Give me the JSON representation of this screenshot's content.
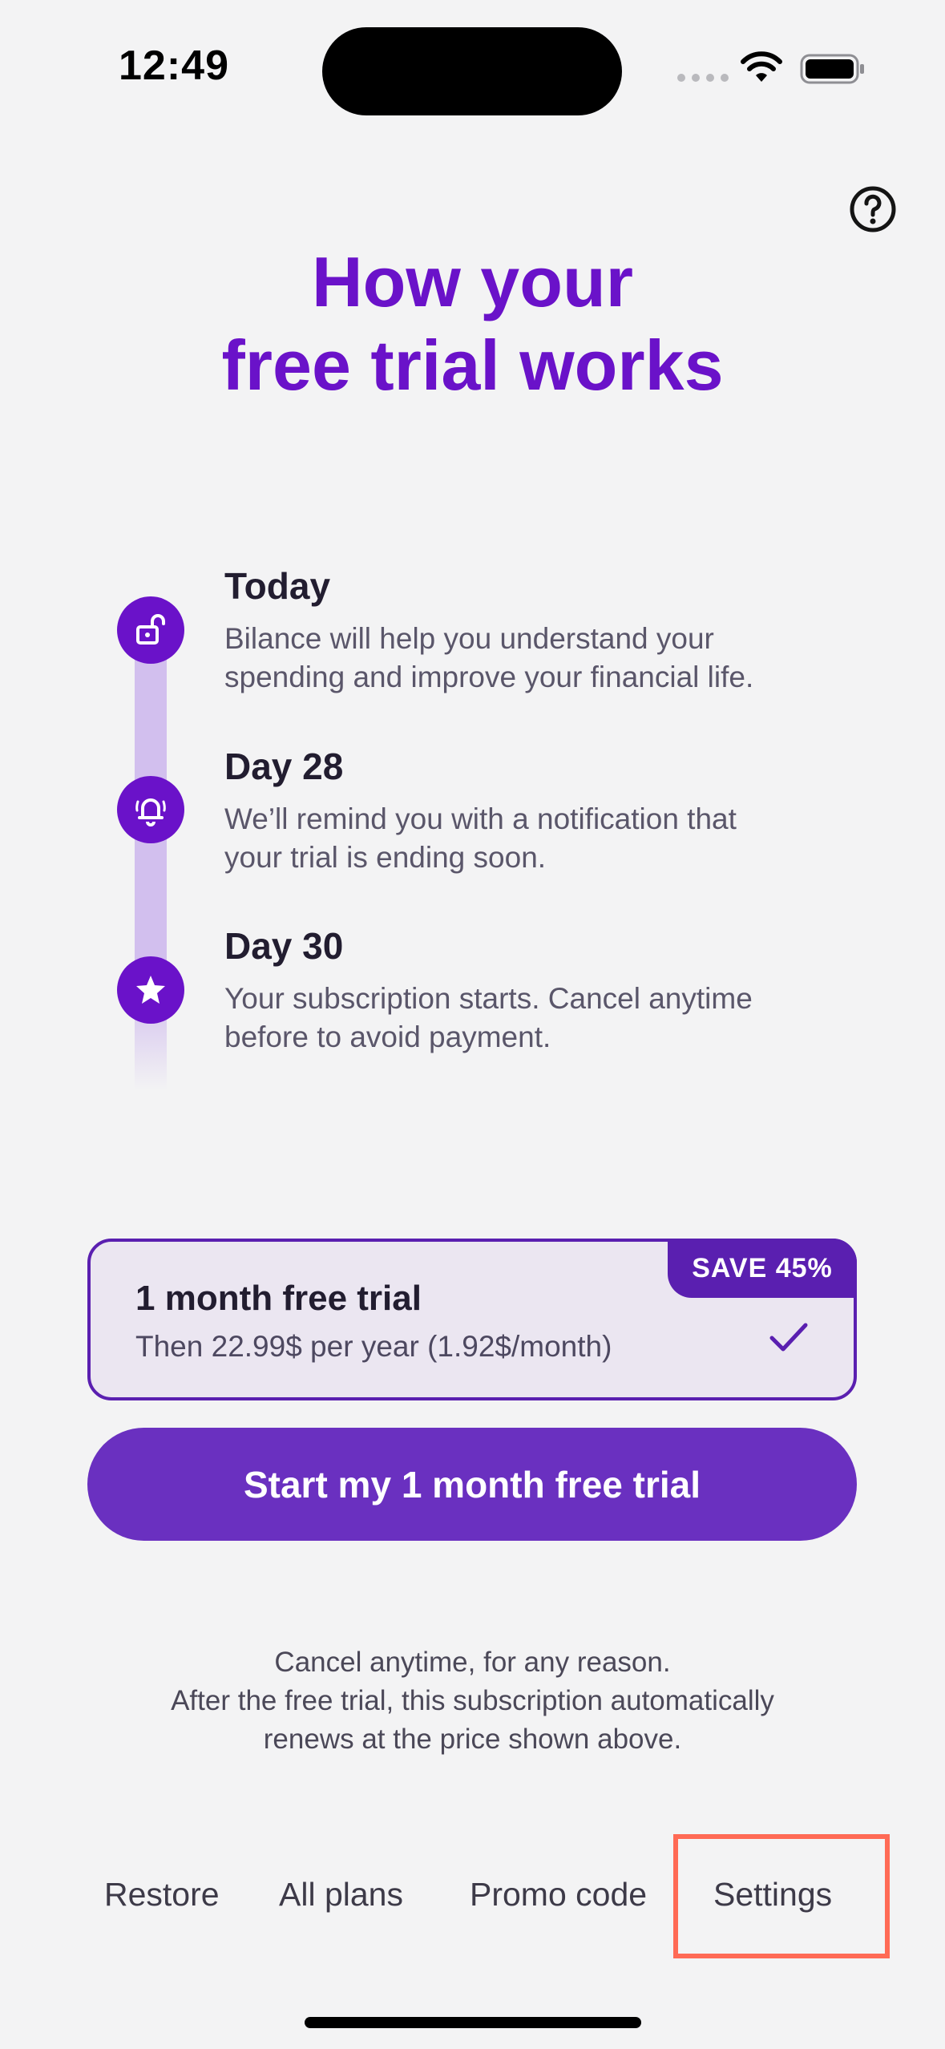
{
  "status_bar": {
    "time": "12:49"
  },
  "header": {
    "title_line1": "How your",
    "title_line2": "free trial works",
    "help_icon": "question-circle-icon"
  },
  "timeline": [
    {
      "title": "Today",
      "description_line1": "Bilance will help you understand your",
      "description_line2": "spending and improve your financial life.",
      "icon": "unlock-icon"
    },
    {
      "title": "Day 28",
      "description_line1": "We’ll remind you with a notification that",
      "description_line2": "your trial is ending soon.",
      "icon": "bell-icon"
    },
    {
      "title": "Day 30",
      "description_line1": "Your subscription starts. Cancel anytime",
      "description_line2": "before to avoid payment.",
      "icon": "star-icon"
    }
  ],
  "plan": {
    "badge": "SAVE 45%",
    "title": "1 month free trial",
    "subtitle": "Then 22.99$ per year (1.92$/month)",
    "selected": true
  },
  "cta": {
    "label": "Start my 1 month free trial"
  },
  "fineprint": {
    "line1": "Cancel anytime, for any reason.",
    "line2": "After the free trial, this subscription automatically",
    "line3": "renews at the price shown above."
  },
  "footer": {
    "restore": "Restore",
    "all_plans": "All plans",
    "promo_code": "Promo code",
    "settings": "Settings"
  },
  "colors": {
    "accent": "#6a12c9",
    "button": "#6a30c0",
    "highlight": "#ff6a55",
    "background": "#f3f3f4"
  }
}
